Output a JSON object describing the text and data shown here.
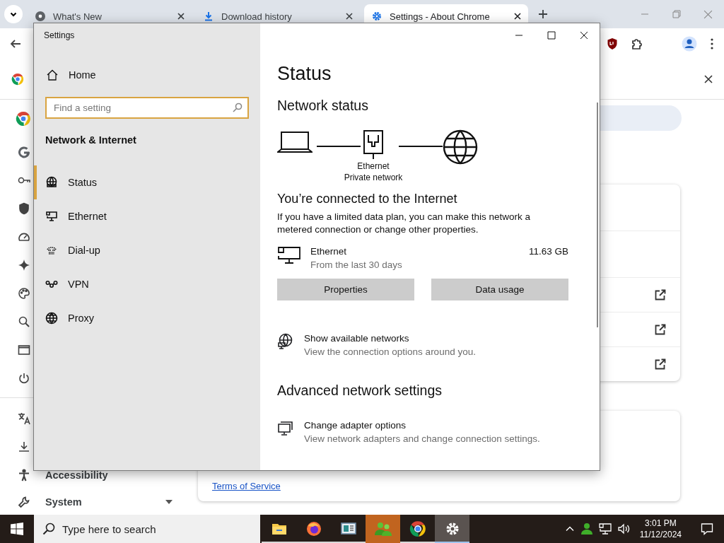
{
  "browser": {
    "tabs": [
      {
        "title": "What's New",
        "kind": "chrome",
        "selected": false
      },
      {
        "title": "Download history",
        "kind": "download",
        "selected": false
      },
      {
        "title": "Settings - About Chrome",
        "kind": "gear",
        "selected": true
      }
    ],
    "sidebar": {
      "items": [
        {
          "label": "Accessibility",
          "kind": "accessibility"
        },
        {
          "label": "System",
          "kind": "wrench"
        }
      ]
    },
    "page": {
      "link": "Terms of Service"
    }
  },
  "settings_window": {
    "title": "Settings",
    "home": "Home",
    "search": {
      "placeholder": "Find a setting"
    },
    "section": "Network & Internet",
    "nav": [
      {
        "label": "Status",
        "kind": "status",
        "selected": true
      },
      {
        "label": "Ethernet",
        "kind": "ethernet",
        "selected": false
      },
      {
        "label": "Dial-up",
        "kind": "dialup",
        "selected": false
      },
      {
        "label": "VPN",
        "kind": "vpn",
        "selected": false
      },
      {
        "label": "Proxy",
        "kind": "proxy",
        "selected": false
      }
    ],
    "content": {
      "title": "Status",
      "subtitle": "Network status",
      "adapter_name": "Ethernet",
      "network_profile": "Private network",
      "connection_heading": "You’re connected to the Internet",
      "connection_text": "If you have a limited data plan, you can make this network a metered connection or change other properties.",
      "usage": {
        "name": "Ethernet",
        "period": "From the last 30 days",
        "amount": "11.63 GB"
      },
      "buttons": [
        "Properties",
        "Data usage"
      ],
      "links": [
        {
          "title": "Show available networks",
          "description": "View the connection options around you.",
          "kind": "networks"
        }
      ],
      "advanced_heading": "Advanced network settings",
      "advanced_links": [
        {
          "title": "Change adapter options",
          "description": "View network adapters and change connection settings.",
          "kind": "adapter"
        }
      ]
    }
  },
  "taskbar": {
    "search_placeholder": "Type here to search",
    "apps": [
      {
        "kind": "explorer",
        "selected": false,
        "flashing": false
      },
      {
        "kind": "firefox",
        "selected": false,
        "flashing": false
      },
      {
        "kind": "monitor",
        "selected": false,
        "flashing": false
      },
      {
        "kind": "people",
        "selected": false,
        "flashing": true
      },
      {
        "kind": "chrome",
        "selected": false,
        "flashing": false
      },
      {
        "kind": "gear",
        "selected": true,
        "flashing": false
      }
    ],
    "time": "3:01 PM",
    "date": "11/12/2024"
  }
}
